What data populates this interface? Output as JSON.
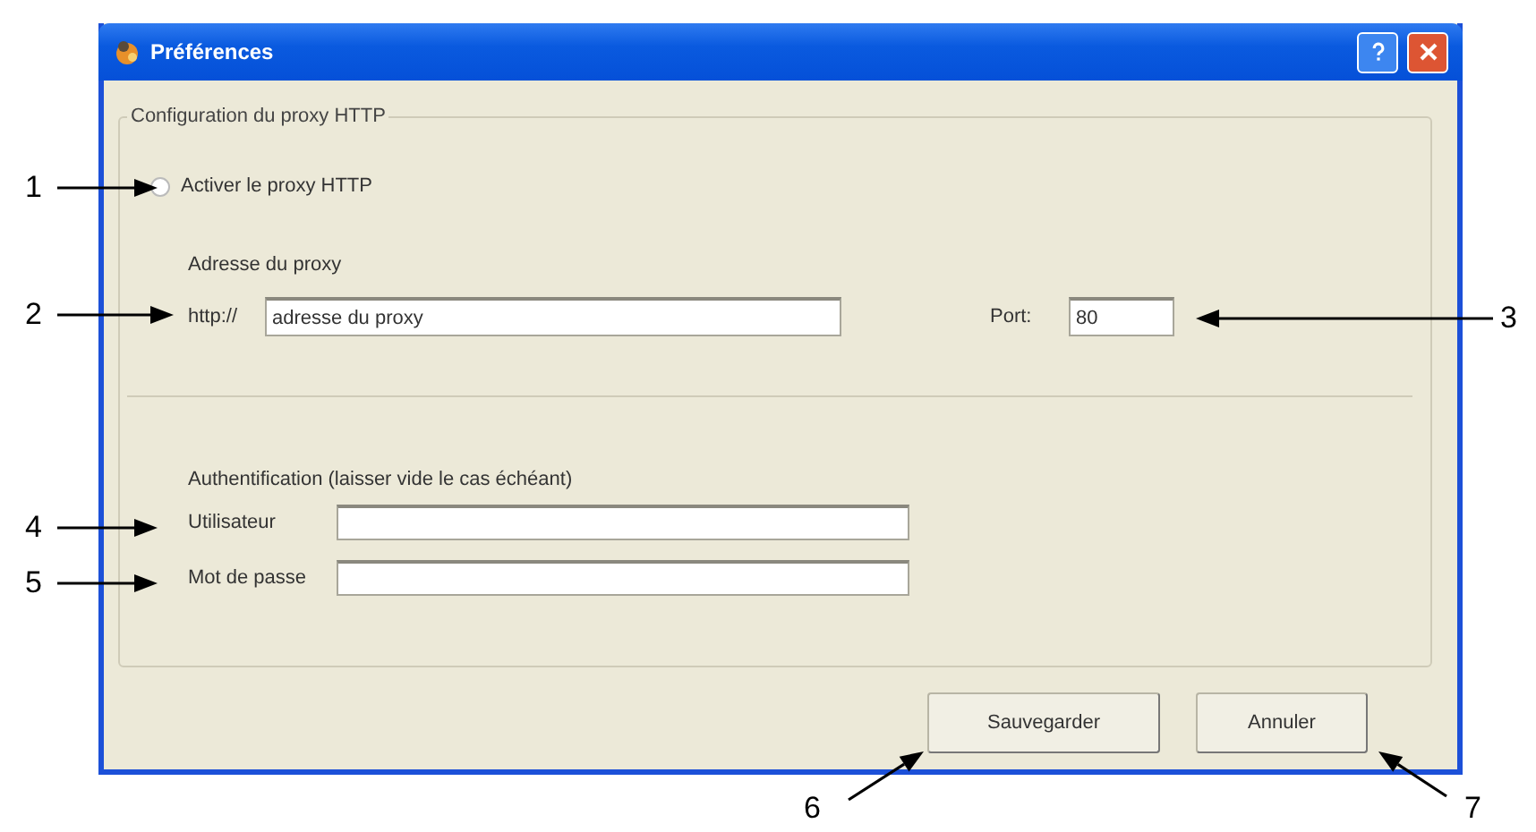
{
  "window": {
    "title": "Préférences"
  },
  "group": {
    "title": "Configuration du proxy HTTP",
    "enable_proxy": {
      "label": "Activer le proxy HTTP",
      "selected": false
    },
    "address_heading": "Adresse du proxy",
    "address_prefix": "http://",
    "address_field": {
      "value": "adresse du proxy"
    },
    "port_label": "Port:",
    "port_field": {
      "value": "80"
    },
    "auth_heading": "Authentification (laisser vide le cas échéant)",
    "auth_fields": [
      {
        "label": "Utilisateur"
      },
      {
        "label": "Mot de passe"
      }
    ]
  },
  "buttons": [
    "Sauvegarder",
    "Annuler"
  ],
  "callouts": [
    {
      "label": "1"
    },
    {
      "label": "2"
    },
    {
      "label": "3"
    },
    {
      "label": "4"
    },
    {
      "label": "5"
    },
    {
      "label": "6"
    },
    {
      "label": "7"
    }
  ]
}
